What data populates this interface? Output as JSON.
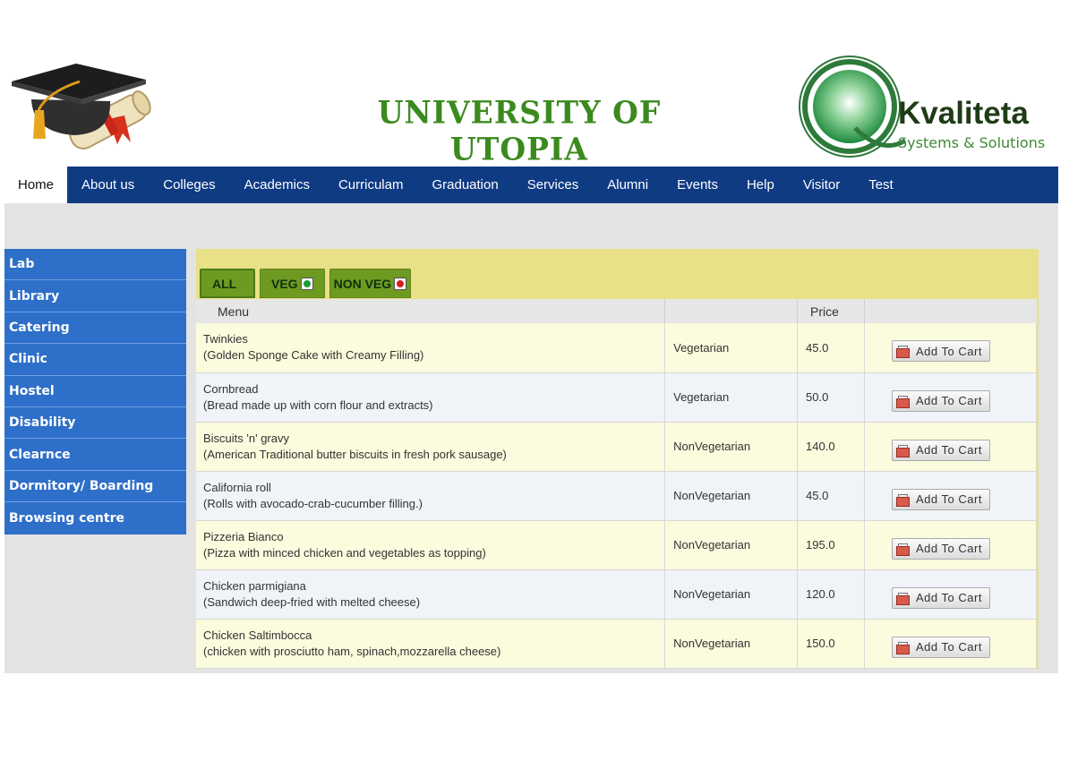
{
  "header": {
    "title": "UNIVERSITY OF UTOPIA",
    "logo_name": "Kvaliteta",
    "logo_sub": "Systems & Solutions"
  },
  "nav": {
    "items": [
      "Home",
      "About us",
      "Colleges",
      "Academics",
      "Curriculam",
      "Graduation",
      "Services",
      "Alumni",
      "Events",
      "Help",
      "Visitor",
      "Test"
    ],
    "active": "Home"
  },
  "sidebar": {
    "items": [
      "Lab",
      "Library",
      "Catering",
      "Clinic",
      "Hostel",
      "Disability",
      "Clearnce",
      "Dormitory/ Boarding",
      "Browsing centre"
    ]
  },
  "tabs": {
    "all": "ALL",
    "veg": "VEG",
    "nonveg": "NON VEG"
  },
  "table": {
    "headers": {
      "menu": "Menu",
      "type": "",
      "price": "Price",
      "action": ""
    },
    "rows": [
      {
        "name": "Twinkies",
        "desc": "(Golden Sponge Cake with Creamy Filling)",
        "type": "Vegetarian",
        "price": "45.0"
      },
      {
        "name": "Cornbread",
        "desc": "(Bread made up with corn flour and extracts)",
        "type": "Vegetarian",
        "price": "50.0"
      },
      {
        "name": "Biscuits 'n' gravy",
        "desc": "(American Traditional butter biscuits in fresh pork sausage)",
        "type": "NonVegetarian",
        "price": "140.0"
      },
      {
        "name": "California roll",
        "desc": "(Rolls with avocado-crab-cucumber filling.)",
        "type": "NonVegetarian",
        "price": "45.0"
      },
      {
        "name": "Pizzeria Bianco",
        "desc": "(Pizza with minced chicken and vegetables as topping)",
        "type": "NonVegetarian",
        "price": "195.0"
      },
      {
        "name": "Chicken parmigiana",
        "desc": "(Sandwich deep-fried with melted cheese)",
        "type": "NonVegetarian",
        "price": "120.0"
      },
      {
        "name": "Chicken Saltimbocca",
        "desc": "(chicken with prosciutto ham, spinach,mozzarella cheese)",
        "type": "NonVegetarian",
        "price": "150.0"
      }
    ],
    "cart_label": "Add To Cart"
  },
  "colors": {
    "nav_bg": "#0f3b83",
    "sidebar_bg": "#2e6fc9",
    "panel_bg": "#e9e188",
    "tab_bg": "#6e9a22",
    "title_green": "#3b8a1e"
  }
}
